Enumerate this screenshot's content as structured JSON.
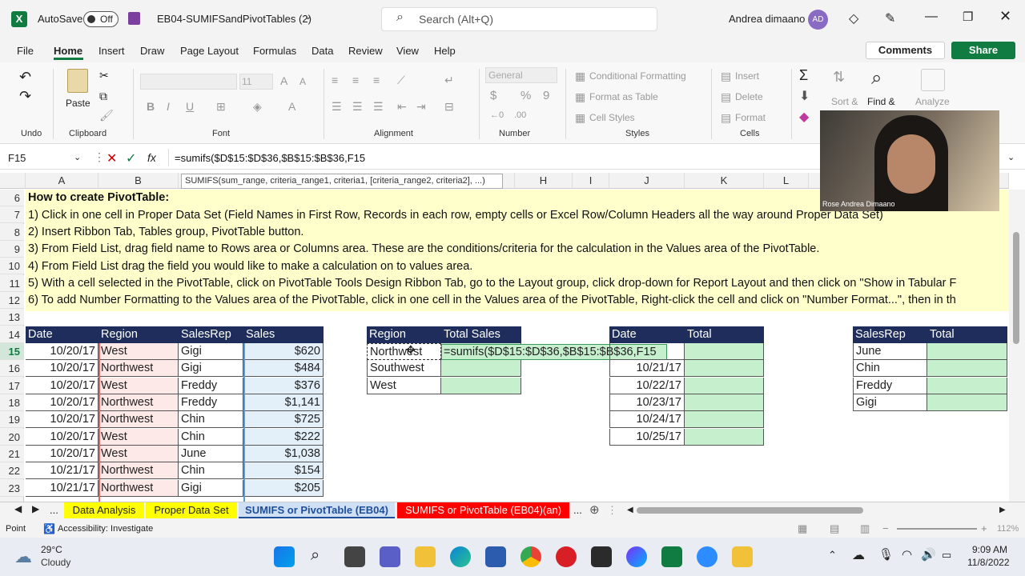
{
  "titlebar": {
    "autosave_label": "AutoSave",
    "autosave_state": "Off",
    "filename": "EB04-SUMIFSandPivotTables (2)",
    "search_placeholder": "Search (Alt+Q)",
    "user_name": "Andrea dimaano",
    "user_initials": "AD"
  },
  "menu": {
    "items": [
      "File",
      "Home",
      "Insert",
      "Draw",
      "Page Layout",
      "Formulas",
      "Data",
      "Review",
      "View",
      "Help"
    ],
    "active": "Home",
    "comments": "Comments",
    "share": "Share"
  },
  "ribbon": {
    "undo": "Undo",
    "clipboard": "Clipboard",
    "paste": "Paste",
    "font": "Font",
    "font_size": "11",
    "alignment": "Alignment",
    "number": "Number",
    "number_format": "General",
    "styles": "Styles",
    "conditional_formatting": "Conditional Formatting",
    "format_as_table": "Format as Table",
    "cell_styles": "Cell Styles",
    "cells": "Cells",
    "insert": "Insert",
    "delete": "Delete",
    "format": "Format",
    "sort_filter": "Sort &",
    "find_select": "Find &",
    "analyze": "Analyze"
  },
  "formula_bar": {
    "name_box": "F15",
    "formula": "=sumifs($D$15:$D$36,$B$15:$B$36,F15",
    "tooltip": "SUMIFS(sum_range, criteria_range1, criteria1, [criteria_range2, criteria2], ...)"
  },
  "columns": [
    "A",
    "B",
    "",
    "",
    "",
    "",
    "",
    "H",
    "I",
    "J",
    "K",
    "L"
  ],
  "rows": [
    "6",
    "7",
    "8",
    "9",
    "10",
    "11",
    "12",
    "13",
    "14",
    "15",
    "16",
    "17",
    "18",
    "19",
    "20",
    "21",
    "22",
    "23"
  ],
  "notes": [
    "How to create PivotTable:",
    "1) Click in one cell in Proper Data Set (Field Names in First Row, Records in each row, empty cells or Excel Row/Column Headers all the way around Proper Data Set)",
    "2) Insert Ribbon Tab, Tables group, PivotTable button.",
    "3) From Field List, drag field name to Rows area or Columns area. These are the conditions/criteria for the calculation in the Values area of the PivotTable.",
    "4) From Field List drag the field you would like to make a calculation on to values area.",
    "5) With a cell selected in the PivotTable, click on PivotTable Tools Design Ribbon Tab, go to the Layout group, click drop-down for Report Layout and then click on \"Show in Tabular F",
    "6) To add Number Formatting to the Values area of the PivotTable, click in one cell in the Values area of the PivotTable, Right-click the cell and click on \"Number Format...\", then in th"
  ],
  "data_table": {
    "headers": [
      "Date",
      "Region",
      "SalesRep",
      "Sales"
    ],
    "rows": [
      [
        "10/20/17",
        "West",
        "Gigi",
        "$620"
      ],
      [
        "10/20/17",
        "Northwest",
        "Gigi",
        "$484"
      ],
      [
        "10/20/17",
        "West",
        "Freddy",
        "$376"
      ],
      [
        "10/20/17",
        "Northwest",
        "Freddy",
        "$1,141"
      ],
      [
        "10/20/17",
        "Northwest",
        "Chin",
        "$725"
      ],
      [
        "10/20/17",
        "West",
        "Chin",
        "$222"
      ],
      [
        "10/20/17",
        "West",
        "June",
        "$1,038"
      ],
      [
        "10/21/17",
        "Northwest",
        "Chin",
        "$154"
      ],
      [
        "10/21/17",
        "Northwest",
        "Gigi",
        "$205"
      ]
    ]
  },
  "region_table": {
    "headers": [
      "Region",
      "Total Sales"
    ],
    "rows": [
      "Northwest",
      "Southwest",
      "West"
    ],
    "editing": "=sumifs($D$15:$D$36,$B$15:$B$36,F15"
  },
  "date_table": {
    "headers": [
      "Date",
      "Total"
    ],
    "rows": [
      "",
      "10/21/17",
      "10/22/17",
      "10/23/17",
      "10/24/17",
      "10/25/17"
    ]
  },
  "rep_table": {
    "headers": [
      "SalesRep",
      "Total"
    ],
    "rows": [
      "June",
      "Chin",
      "Freddy",
      "Gigi"
    ]
  },
  "sheet_tabs": [
    {
      "label": "Data Analysis",
      "bg": "#ffff00",
      "color": "#222"
    },
    {
      "label": "Proper Data Set",
      "bg": "#ffff00",
      "color": "#222"
    },
    {
      "label": "SUMIFS or PivotTable (EB04)",
      "bg": "#cfe0f5",
      "color": "#1f4e9a"
    },
    {
      "label": "SUMIFS or PivotTable (EB04)(an)",
      "bg": "#ff0000",
      "color": "#ffffff"
    }
  ],
  "status": {
    "mode": "Point",
    "accessibility": "Accessibility: Investigate",
    "zoom": "112%"
  },
  "video": {
    "caption": "Rose Andrea Dimaano"
  },
  "taskbar": {
    "temp": "29°C",
    "weather": "Cloudy",
    "time": "9:09 AM",
    "date": "11/8/2022"
  }
}
